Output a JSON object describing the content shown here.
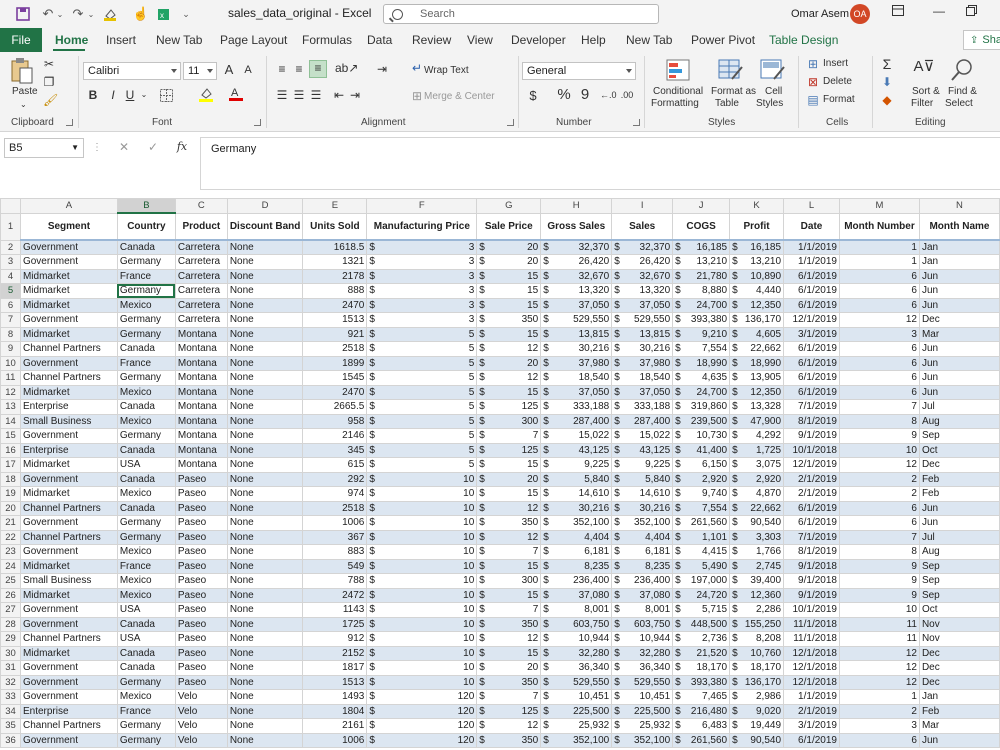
{
  "titlebar": {
    "doc_title": "sales_data_original  -  Excel",
    "search_placeholder": "Search",
    "user": "Omar Asem",
    "avatar_initials": "OA"
  },
  "tabs": {
    "file": "File",
    "items": [
      "Home",
      "Insert",
      "New Tab",
      "Page Layout",
      "Formulas",
      "Data",
      "Review",
      "View",
      "Developer",
      "Help",
      "New Tab",
      "Power Pivot",
      "Table Design"
    ],
    "share": "Sha"
  },
  "ribbon": {
    "clipboard": {
      "paste": "Paste",
      "label": "Clipboard"
    },
    "font": {
      "name": "Calibri",
      "size": "11",
      "bold": "B",
      "italic": "I",
      "underline": "U",
      "label": "Font",
      "grow": "A",
      "shrink": "A"
    },
    "alignment": {
      "wrap": "Wrap Text",
      "merge": "Merge & Center",
      "label": "Alignment"
    },
    "number": {
      "format": "General",
      "currency": "$",
      "percent": "%",
      "comma": "9",
      "label": "Number"
    },
    "styles": {
      "conditional": "Conditional",
      "conditional2": "Formatting",
      "format_as": "Format as",
      "format_as2": "Table",
      "cell": "Cell",
      "cell2": "Styles",
      "label": "Styles"
    },
    "cells": {
      "insert": "Insert",
      "delete": "Delete",
      "format": "Format",
      "label": "Cells"
    },
    "editing": {
      "sort": "Sort &",
      "sort2": "Filter",
      "find": "Find &",
      "find2": "Select",
      "label": "Editing"
    }
  },
  "formula": {
    "name_box": "B5",
    "content": "Germany",
    "fx": "fx"
  },
  "grid": {
    "columns": [
      "A",
      "B",
      "C",
      "D",
      "E",
      "F",
      "G",
      "H",
      "I",
      "J",
      "K",
      "L",
      "M",
      "N"
    ],
    "selected_column": "B",
    "selected_row": 5,
    "headers": [
      "Segment",
      "Country",
      "Product",
      "Discount Band",
      "Units Sold",
      "Manufacturing Price",
      "Sale Price",
      "Gross Sales",
      "Sales",
      "COGS",
      "Profit",
      "Date",
      "Month Number",
      "Month Name"
    ],
    "rows": [
      [
        "Government",
        "Canada",
        "Carretera",
        "None",
        "1618.5",
        "3",
        "20",
        "32,370",
        "32,370",
        "16,185",
        "16,185",
        "1/1/2019",
        "1",
        "Jan"
      ],
      [
        "Government",
        "Germany",
        "Carretera",
        "None",
        "1321",
        "3",
        "20",
        "26,420",
        "26,420",
        "13,210",
        "13,210",
        "1/1/2019",
        "1",
        "Jan"
      ],
      [
        "Midmarket",
        "France",
        "Carretera",
        "None",
        "2178",
        "3",
        "15",
        "32,670",
        "32,670",
        "21,780",
        "10,890",
        "6/1/2019",
        "6",
        "Jun"
      ],
      [
        "Midmarket",
        "Germany",
        "Carretera",
        "None",
        "888",
        "3",
        "15",
        "13,320",
        "13,320",
        "8,880",
        "4,440",
        "6/1/2019",
        "6",
        "Jun"
      ],
      [
        "Midmarket",
        "Mexico",
        "Carretera",
        "None",
        "2470",
        "3",
        "15",
        "37,050",
        "37,050",
        "24,700",
        "12,350",
        "6/1/2019",
        "6",
        "Jun"
      ],
      [
        "Government",
        "Germany",
        "Carretera",
        "None",
        "1513",
        "3",
        "350",
        "529,550",
        "529,550",
        "393,380",
        "136,170",
        "12/1/2019",
        "12",
        "Dec"
      ],
      [
        "Midmarket",
        "Germany",
        "Montana",
        "None",
        "921",
        "5",
        "15",
        "13,815",
        "13,815",
        "9,210",
        "4,605",
        "3/1/2019",
        "3",
        "Mar"
      ],
      [
        "Channel Partners",
        "Canada",
        "Montana",
        "None",
        "2518",
        "5",
        "12",
        "30,216",
        "30,216",
        "7,554",
        "22,662",
        "6/1/2019",
        "6",
        "Jun"
      ],
      [
        "Government",
        "France",
        "Montana",
        "None",
        "1899",
        "5",
        "20",
        "37,980",
        "37,980",
        "18,990",
        "18,990",
        "6/1/2019",
        "6",
        "Jun"
      ],
      [
        "Channel Partners",
        "Germany",
        "Montana",
        "None",
        "1545",
        "5",
        "12",
        "18,540",
        "18,540",
        "4,635",
        "13,905",
        "6/1/2019",
        "6",
        "Jun"
      ],
      [
        "Midmarket",
        "Mexico",
        "Montana",
        "None",
        "2470",
        "5",
        "15",
        "37,050",
        "37,050",
        "24,700",
        "12,350",
        "6/1/2019",
        "6",
        "Jun"
      ],
      [
        "Enterprise",
        "Canada",
        "Montana",
        "None",
        "2665.5",
        "5",
        "125",
        "333,188",
        "333,188",
        "319,860",
        "13,328",
        "7/1/2019",
        "7",
        "Jul"
      ],
      [
        "Small Business",
        "Mexico",
        "Montana",
        "None",
        "958",
        "5",
        "300",
        "287,400",
        "287,400",
        "239,500",
        "47,900",
        "8/1/2019",
        "8",
        "Aug"
      ],
      [
        "Government",
        "Germany",
        "Montana",
        "None",
        "2146",
        "5",
        "7",
        "15,022",
        "15,022",
        "10,730",
        "4,292",
        "9/1/2019",
        "9",
        "Sep"
      ],
      [
        "Enterprise",
        "Canada",
        "Montana",
        "None",
        "345",
        "5",
        "125",
        "43,125",
        "43,125",
        "41,400",
        "1,725",
        "10/1/2018",
        "10",
        "Oct"
      ],
      [
        "Midmarket",
        "USA",
        "Montana",
        "None",
        "615",
        "5",
        "15",
        "9,225",
        "9,225",
        "6,150",
        "3,075",
        "12/1/2019",
        "12",
        "Dec"
      ],
      [
        "Government",
        "Canada",
        "Paseo",
        "None",
        "292",
        "10",
        "20",
        "5,840",
        "5,840",
        "2,920",
        "2,920",
        "2/1/2019",
        "2",
        "Feb"
      ],
      [
        "Midmarket",
        "Mexico",
        "Paseo",
        "None",
        "974",
        "10",
        "15",
        "14,610",
        "14,610",
        "9,740",
        "4,870",
        "2/1/2019",
        "2",
        "Feb"
      ],
      [
        "Channel Partners",
        "Canada",
        "Paseo",
        "None",
        "2518",
        "10",
        "12",
        "30,216",
        "30,216",
        "7,554",
        "22,662",
        "6/1/2019",
        "6",
        "Jun"
      ],
      [
        "Government",
        "Germany",
        "Paseo",
        "None",
        "1006",
        "10",
        "350",
        "352,100",
        "352,100",
        "261,560",
        "90,540",
        "6/1/2019",
        "6",
        "Jun"
      ],
      [
        "Channel Partners",
        "Germany",
        "Paseo",
        "None",
        "367",
        "10",
        "12",
        "4,404",
        "4,404",
        "1,101",
        "3,303",
        "7/1/2019",
        "7",
        "Jul"
      ],
      [
        "Government",
        "Mexico",
        "Paseo",
        "None",
        "883",
        "10",
        "7",
        "6,181",
        "6,181",
        "4,415",
        "1,766",
        "8/1/2019",
        "8",
        "Aug"
      ],
      [
        "Midmarket",
        "France",
        "Paseo",
        "None",
        "549",
        "10",
        "15",
        "8,235",
        "8,235",
        "5,490",
        "2,745",
        "9/1/2018",
        "9",
        "Sep"
      ],
      [
        "Small Business",
        "Mexico",
        "Paseo",
        "None",
        "788",
        "10",
        "300",
        "236,400",
        "236,400",
        "197,000",
        "39,400",
        "9/1/2018",
        "9",
        "Sep"
      ],
      [
        "Midmarket",
        "Mexico",
        "Paseo",
        "None",
        "2472",
        "10",
        "15",
        "37,080",
        "37,080",
        "24,720",
        "12,360",
        "9/1/2019",
        "9",
        "Sep"
      ],
      [
        "Government",
        "USA",
        "Paseo",
        "None",
        "1143",
        "10",
        "7",
        "8,001",
        "8,001",
        "5,715",
        "2,286",
        "10/1/2019",
        "10",
        "Oct"
      ],
      [
        "Government",
        "Canada",
        "Paseo",
        "None",
        "1725",
        "10",
        "350",
        "603,750",
        "603,750",
        "448,500",
        "155,250",
        "11/1/2018",
        "11",
        "Nov"
      ],
      [
        "Channel Partners",
        "USA",
        "Paseo",
        "None",
        "912",
        "10",
        "12",
        "10,944",
        "10,944",
        "2,736",
        "8,208",
        "11/1/2018",
        "11",
        "Nov"
      ],
      [
        "Midmarket",
        "Canada",
        "Paseo",
        "None",
        "2152",
        "10",
        "15",
        "32,280",
        "32,280",
        "21,520",
        "10,760",
        "12/1/2018",
        "12",
        "Dec"
      ],
      [
        "Government",
        "Canada",
        "Paseo",
        "None",
        "1817",
        "10",
        "20",
        "36,340",
        "36,340",
        "18,170",
        "18,170",
        "12/1/2018",
        "12",
        "Dec"
      ],
      [
        "Government",
        "Germany",
        "Paseo",
        "None",
        "1513",
        "10",
        "350",
        "529,550",
        "529,550",
        "393,380",
        "136,170",
        "12/1/2018",
        "12",
        "Dec"
      ],
      [
        "Government",
        "Mexico",
        "Velo",
        "None",
        "1493",
        "120",
        "7",
        "10,451",
        "10,451",
        "7,465",
        "2,986",
        "1/1/2019",
        "1",
        "Jan"
      ],
      [
        "Enterprise",
        "France",
        "Velo",
        "None",
        "1804",
        "120",
        "125",
        "225,500",
        "225,500",
        "216,480",
        "9,020",
        "2/1/2019",
        "2",
        "Feb"
      ],
      [
        "Channel Partners",
        "Germany",
        "Velo",
        "None",
        "2161",
        "120",
        "12",
        "25,932",
        "25,932",
        "6,483",
        "19,449",
        "3/1/2019",
        "3",
        "Mar"
      ],
      [
        "Government",
        "Germany",
        "Velo",
        "None",
        "1006",
        "120",
        "350",
        "352,100",
        "352,100",
        "261,560",
        "90,540",
        "6/1/2019",
        "6",
        "Jun"
      ]
    ]
  }
}
